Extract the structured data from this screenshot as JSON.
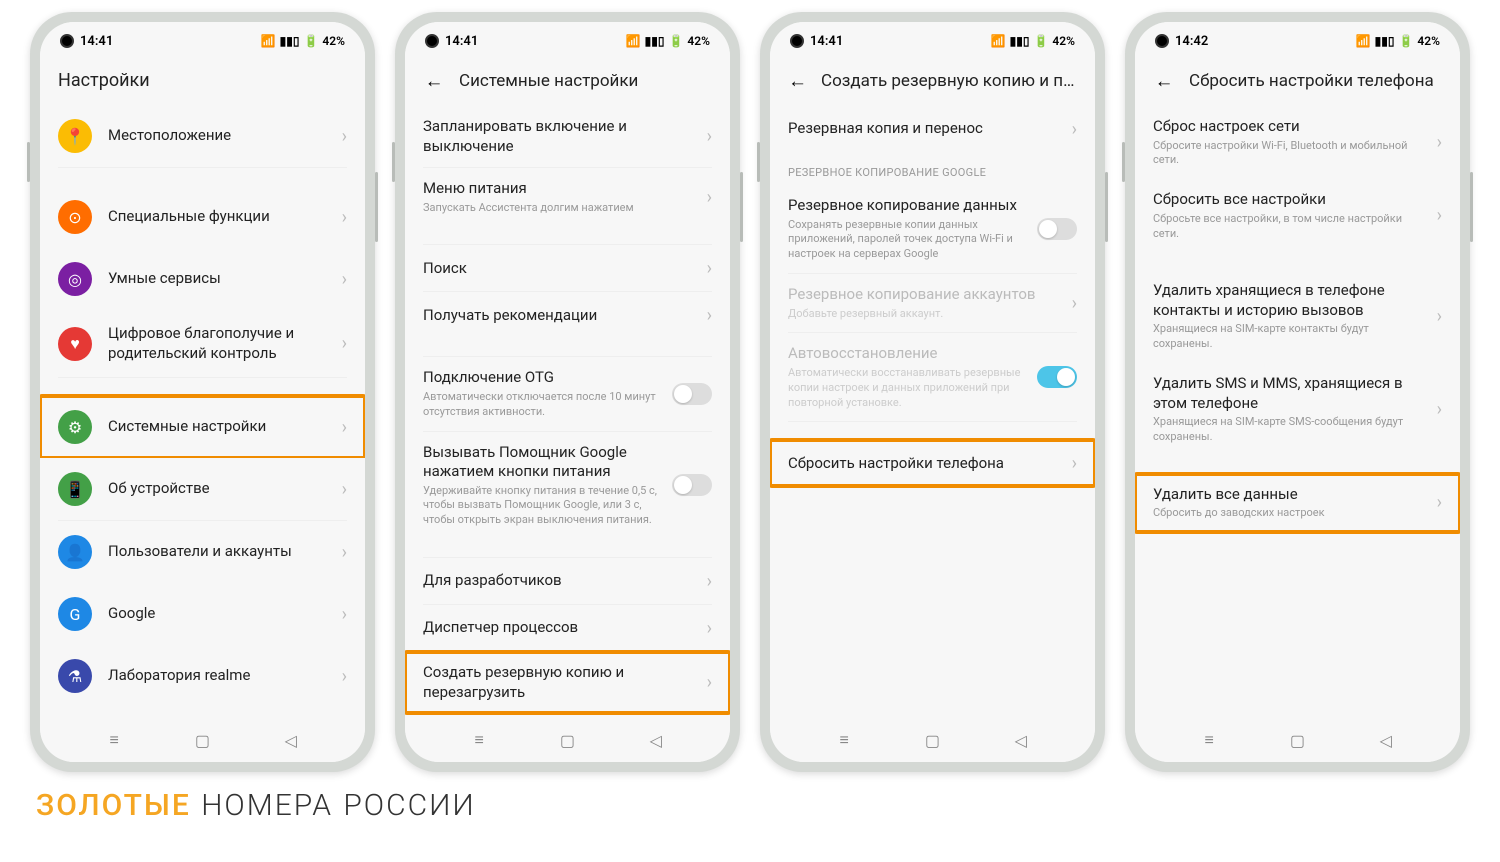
{
  "status": {
    "time1": "14:41",
    "time2": "14:42",
    "battery": "42%"
  },
  "phone1": {
    "title": "Настройки",
    "items": [
      {
        "title": "Местоположение",
        "icon_color": "#fbbc04",
        "icon": "📍"
      },
      {
        "title": "Специальные функции",
        "icon_color": "#ff6d00",
        "icon": "⊙"
      },
      {
        "title": "Умные сервисы",
        "icon_color": "#7b1fa2",
        "icon": "◎"
      },
      {
        "title": "Цифровое благополучие и родительский контроль",
        "icon_color": "#e53935",
        "icon": "♥"
      },
      {
        "title": "Системные настройки",
        "icon_color": "#43a047",
        "icon": "⚙",
        "highlight": true
      },
      {
        "title": "Об устройстве",
        "icon_color": "#43a047",
        "icon": "📱"
      },
      {
        "title": "Пользователи и аккаунты",
        "icon_color": "#1e88e5",
        "icon": "👤"
      },
      {
        "title": "Google",
        "icon_color": "#1e88e5",
        "icon": "G"
      },
      {
        "title": "Лаборатория realme",
        "icon_color": "#3949ab",
        "icon": "⚗"
      }
    ]
  },
  "phone2": {
    "title": "Системные настройки",
    "items": [
      {
        "title": "Запланировать включение и выключение"
      },
      {
        "title": "Меню питания",
        "sub": "Запускать Ассистента долгим нажатием"
      },
      {
        "title": "Поиск"
      },
      {
        "title": "Получать рекомендации"
      },
      {
        "title": "Подключение OTG",
        "sub": "Автоматически отключается после 10 минут отсутствия активности.",
        "toggle": "off"
      },
      {
        "title": "Вызывать Помощник Google нажатием кнопки питания",
        "sub": "Удерживайте кнопку питания в течение 0,5 с, чтобы вызвать Помощник Google, или 3 с, чтобы открыть экран выключения питания.",
        "toggle": "off"
      },
      {
        "title": "Для разработчиков"
      },
      {
        "title": "Диспетчер процессов"
      },
      {
        "title": "Создать резервную копию и перезагрузить",
        "highlight": true
      }
    ]
  },
  "phone3": {
    "title": "Создать резервную копию и перезаг…",
    "section": "РЕЗЕРВНОЕ КОПИРОВАНИЕ GOOGLE",
    "items": [
      {
        "title": "Резервная копия и перенос"
      },
      {
        "title": "Резервное копирование данных",
        "sub": "Сохранять резервные копии данных приложений, паролей точек доступа Wi-Fi и настроек на серверах Google",
        "toggle": "off"
      },
      {
        "title": "Резервное копирование аккаунтов",
        "sub": "Добавьте резервный аккаунт.",
        "disabled": true
      },
      {
        "title": "Автовосстановление",
        "sub": "Автоматически восстанавливать резервные копии настроек и данных приложений при повторной установке.",
        "toggle": "on",
        "disabled": true
      },
      {
        "title": "Сбросить настройки телефона",
        "highlight": true
      }
    ]
  },
  "phone4": {
    "title": "Сбросить настройки телефона",
    "items": [
      {
        "title": "Сброс настроек сети",
        "sub": "Сбросите настройки Wi-Fi, Bluetooth и мобильной сети."
      },
      {
        "title": "Сбросить все настройки",
        "sub": "Сбросьте все настройки, в том числе настройки сети."
      },
      {
        "title": "Удалить хранящиеся в телефоне контакты и историю вызовов",
        "sub": "Хранящиеся на SIM-карте контакты будут сохранены."
      },
      {
        "title": "Удалить SMS и MMS, хранящиеся в этом телефоне",
        "sub": "Хранящиеся на SIM-карте SMS-сообщения будут сохранены."
      },
      {
        "title": "Удалить все данные",
        "sub": "Сбросить до заводских настроек",
        "highlight": true
      }
    ]
  },
  "logo_text": {
    "p1": "ЗОЛОТЫЕ",
    "p2": "НОМЕРА",
    "p3": "РОССИИ"
  }
}
